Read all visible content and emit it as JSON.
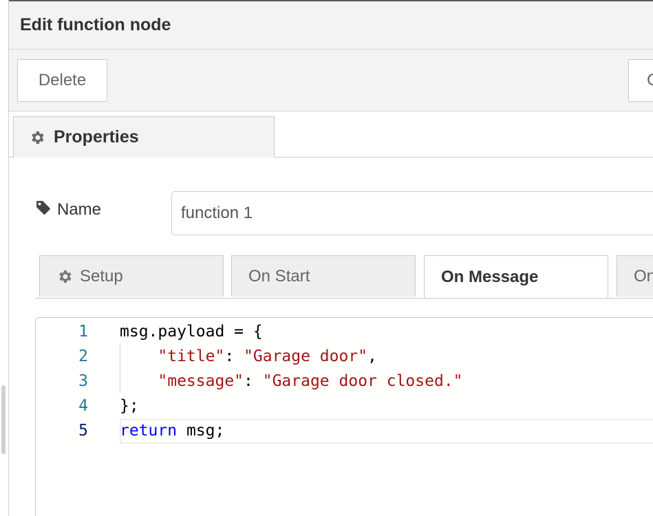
{
  "tray": {
    "title": "Edit function node"
  },
  "toolbar": {
    "delete_label": "Delete",
    "cancel_label": "Cancel"
  },
  "properties_tab": {
    "label": "Properties",
    "icon": "gear-icon"
  },
  "name_field": {
    "label": "Name",
    "icon": "tag-icon",
    "value": "function 1"
  },
  "code_tabs": [
    {
      "label": "Setup",
      "icon": "gear-icon",
      "active": false
    },
    {
      "label": "On Start",
      "active": false
    },
    {
      "label": "On Message",
      "active": true
    },
    {
      "label": "On Stop",
      "active": false
    }
  ],
  "editor": {
    "language": "javascript",
    "current_line": 5,
    "lines": [
      {
        "number": "1",
        "text": "msg.payload = {"
      },
      {
        "number": "2",
        "text": "    \"title\": \"Garage door\","
      },
      {
        "number": "3",
        "text": "    \"message\": \"Garage door closed.\""
      },
      {
        "number": "4",
        "text": "};"
      },
      {
        "number": "5",
        "text": "return msg;"
      }
    ],
    "colors": {
      "line_number": "#237893",
      "string": "#a31515",
      "keyword": "#0000ff"
    }
  }
}
